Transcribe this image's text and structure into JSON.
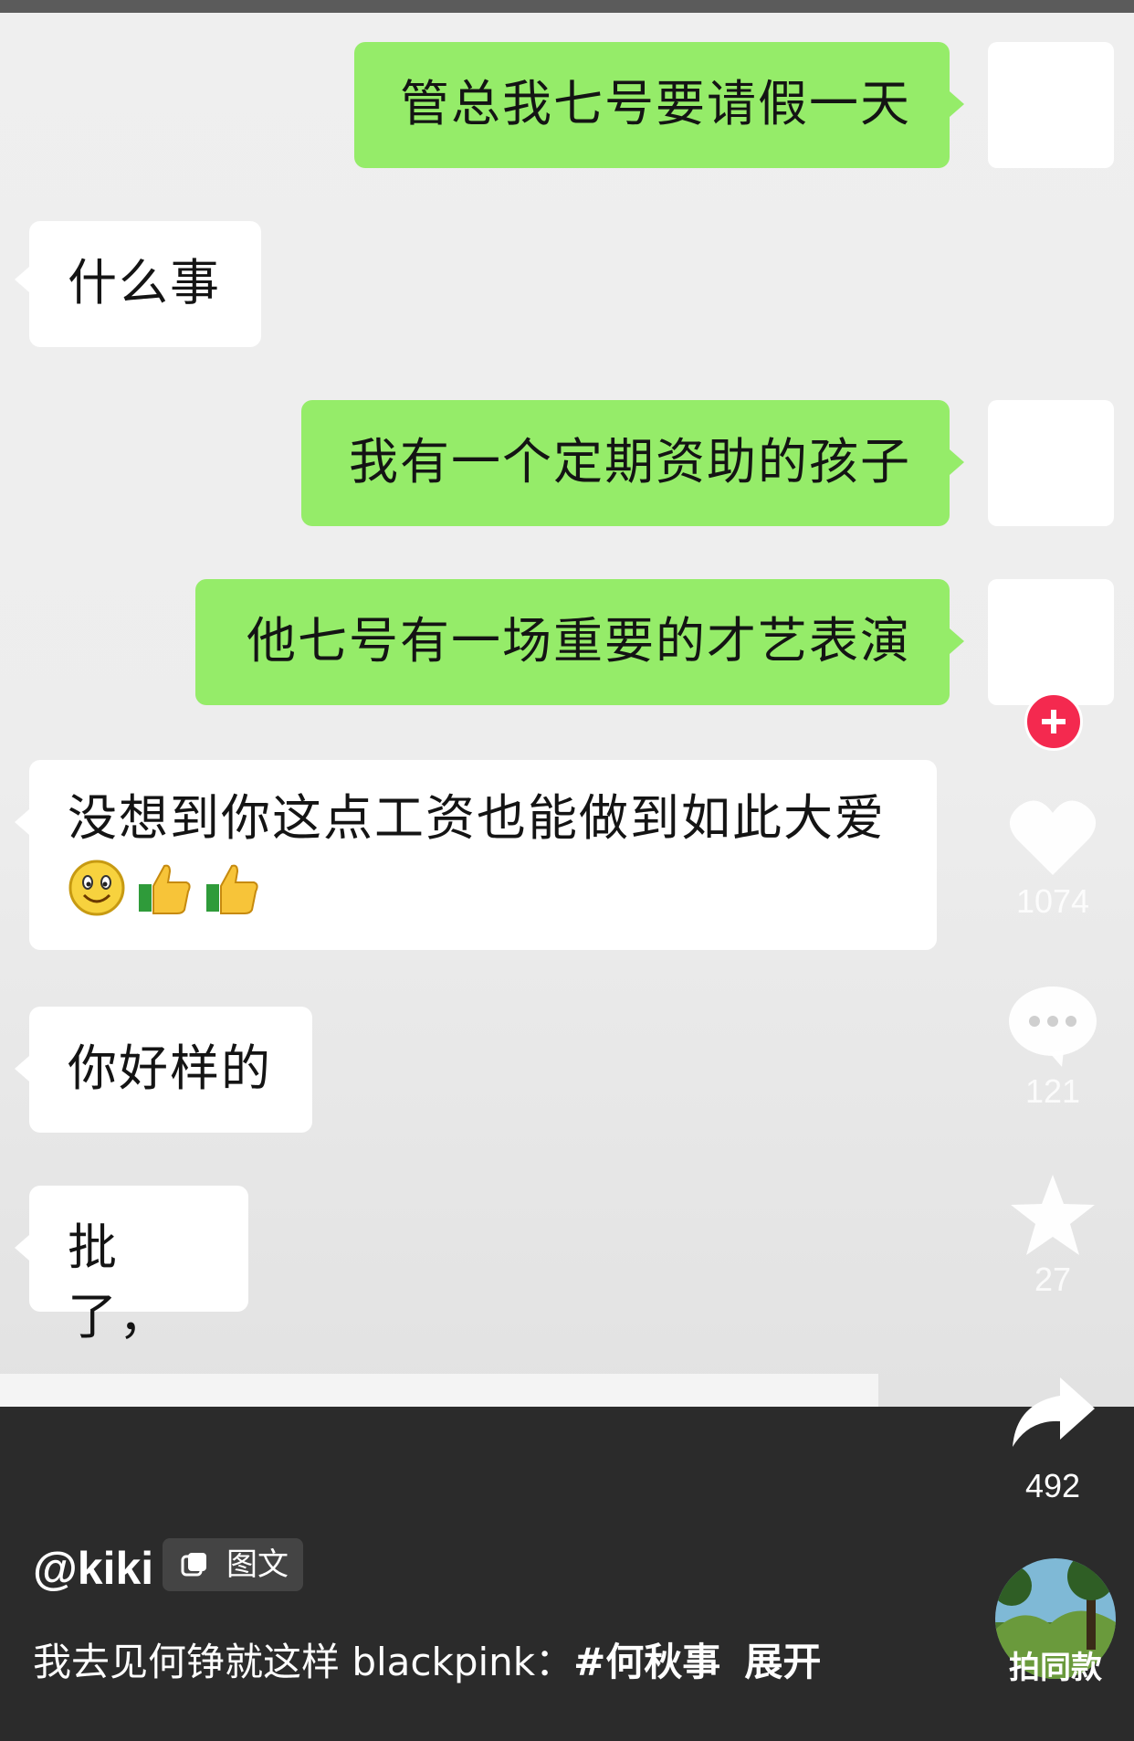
{
  "messages": [
    {
      "text": "管总我七号要请假一天"
    },
    {
      "text": "什么事"
    },
    {
      "text": "我有一个定期资助的孩子"
    },
    {
      "text": "他七号有一场重要的才艺表演"
    },
    {
      "text": "没想到你这点工资也能做到如此大爱"
    },
    {
      "text": "你好样的"
    },
    {
      "text": "批了，"
    }
  ],
  "actions": {
    "like_count": "1074",
    "comment_count": "121",
    "favorite_count": "27",
    "share_count": "492"
  },
  "post": {
    "username": "@kiki",
    "type_tag": "图文",
    "caption": "我去见何铮就这样 blackpink：",
    "hashtag": "#何秋事",
    "expand": "展开",
    "music_label": "拍同款"
  },
  "icons": {
    "follow": "plus-icon",
    "like": "heart-icon",
    "comment": "comment-bubble-icon",
    "favorite": "star-icon",
    "share": "share-arrow-icon"
  },
  "colors": {
    "sent_bubble": "#95ec69",
    "received_bubble": "#ffffff",
    "follow_button": "#f4294f"
  }
}
